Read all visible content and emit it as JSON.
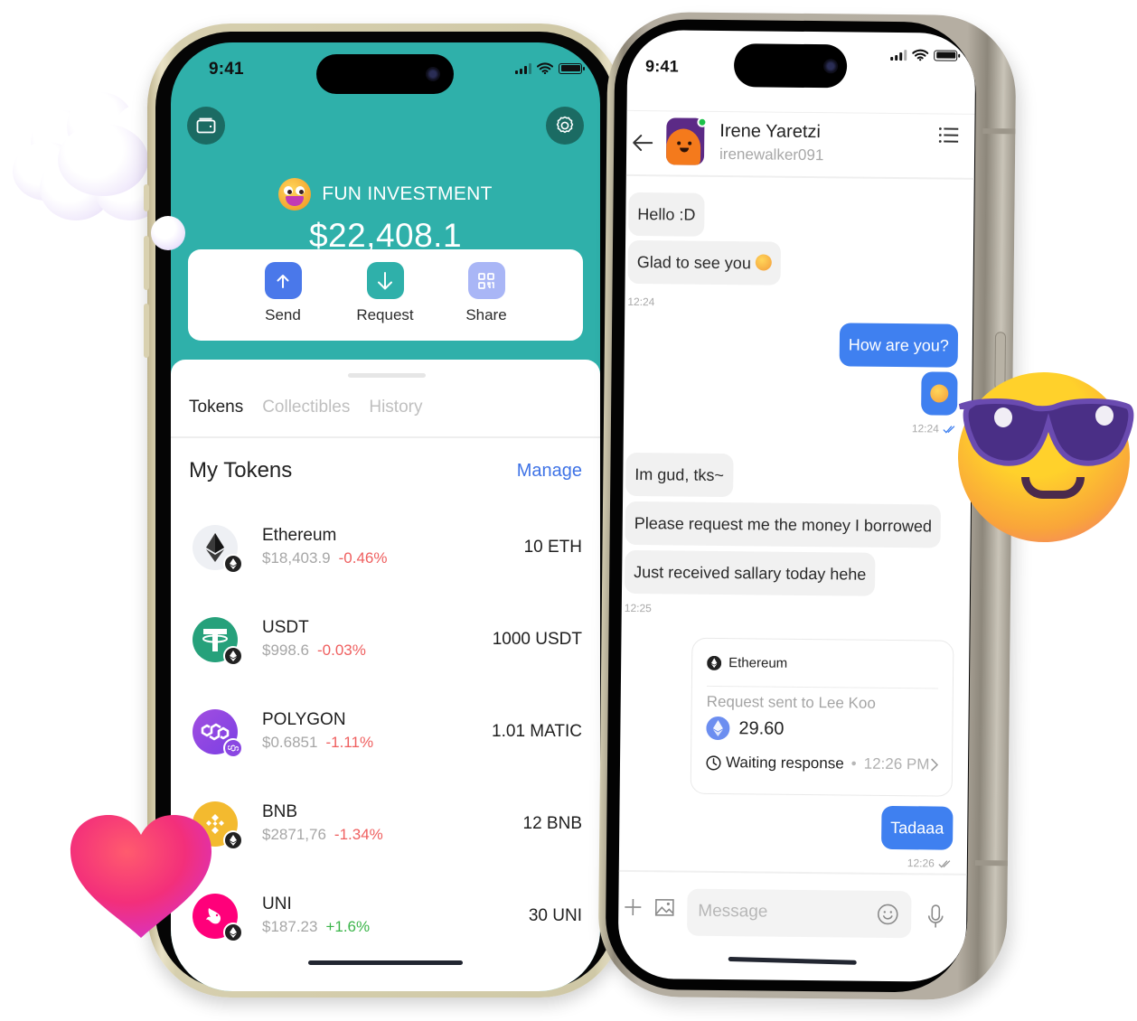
{
  "wallet_phone": {
    "status_bar": {
      "time": "9:41"
    },
    "header": {
      "wallet_icon": "wallet-icon",
      "settings_icon": "gear-icon",
      "account_emoji": "grinning-face-emoji",
      "account_name": "FUN INVESTMENT",
      "balance": "$22,408.1"
    },
    "actions": [
      {
        "label": "Send",
        "icon": "arrow-up-icon",
        "color": "#4a78ea"
      },
      {
        "label": "Request",
        "icon": "arrow-down-icon",
        "color": "#2fb0aa"
      },
      {
        "label": "Share",
        "icon": "qr-code-icon",
        "color": "#a9b6f6"
      }
    ],
    "tabs": [
      {
        "label": "Tokens",
        "active": true
      },
      {
        "label": "Collectibles",
        "active": false
      },
      {
        "label": "History",
        "active": false
      }
    ],
    "section_title": "My Tokens",
    "manage_label": "Manage",
    "tokens": [
      {
        "name": "Ethereum",
        "price": "$18,403.9",
        "change": "-0.46%",
        "direction": "negative",
        "amount": "10 ETH",
        "logo": "ethereum-logo",
        "chain": "ethereum-chain-icon"
      },
      {
        "name": "USDT",
        "price": "$998.6",
        "change": "-0.03%",
        "direction": "negative",
        "amount": "1000 USDT",
        "logo": "tether-logo",
        "chain": "ethereum-chain-icon"
      },
      {
        "name": "POLYGON",
        "price": "$0.6851",
        "change": "-1.11%",
        "direction": "negative",
        "amount": "1.01 MATIC",
        "logo": "polygon-logo",
        "chain": "polygon-chain-icon"
      },
      {
        "name": "BNB",
        "price": "$2871,76",
        "change": "-1.34%",
        "direction": "negative",
        "amount": "12 BNB",
        "logo": "bnb-logo",
        "chain": "ethereum-chain-icon"
      },
      {
        "name": "UNI",
        "price": "$187.23",
        "change": "+1.6%",
        "direction": "positive",
        "amount": "30 UNI",
        "logo": "uniswap-logo",
        "chain": "ethereum-chain-icon"
      }
    ],
    "colors": {
      "header_bg": "#2fb0aa",
      "accent": "#3f73e6",
      "negative": "#ef5f5f",
      "positive": "#3bb54a"
    }
  },
  "chat_phone": {
    "status_bar": {
      "time": "9:41"
    },
    "contact": {
      "name": "Irene Yaretzi",
      "handle": "irenewalker091",
      "online": true
    },
    "messages": [
      {
        "from": "them",
        "text": "Hello :D"
      },
      {
        "from": "them",
        "text": "Glad to see you",
        "emoji": "beaming-face-emoji"
      },
      {
        "timestamp": "12:24",
        "side": "left"
      },
      {
        "from": "me",
        "text": "How are you?"
      },
      {
        "from": "me",
        "emoji": "beaming-face-emoji"
      },
      {
        "timestamp": "12:24",
        "side": "right",
        "read": true
      },
      {
        "from": "them",
        "text": "Im gud, tks~"
      },
      {
        "from": "them",
        "text": "Please request me the money I borrowed"
      },
      {
        "from": "them",
        "text": "Just received sallary today hehe"
      },
      {
        "timestamp": "12:25",
        "side": "left"
      },
      {
        "from": "me",
        "text": "Tadaaa"
      },
      {
        "timestamp": "12:26",
        "side": "right",
        "read": false
      }
    ],
    "request_card": {
      "network": "Ethereum",
      "description": "Request sent to Lee Koo",
      "amount": "29.60",
      "status": "Waiting response",
      "separator": "•",
      "time": "12:26 PM"
    },
    "composer": {
      "placeholder": "Message"
    },
    "colors": {
      "outgoing_bubble": "#3f80f0",
      "incoming_bubble": "#f1f1f1",
      "online": "#1dc24a"
    }
  },
  "decorations": [
    "thought-cloud",
    "cool-sunglasses-emoji",
    "heart"
  ]
}
